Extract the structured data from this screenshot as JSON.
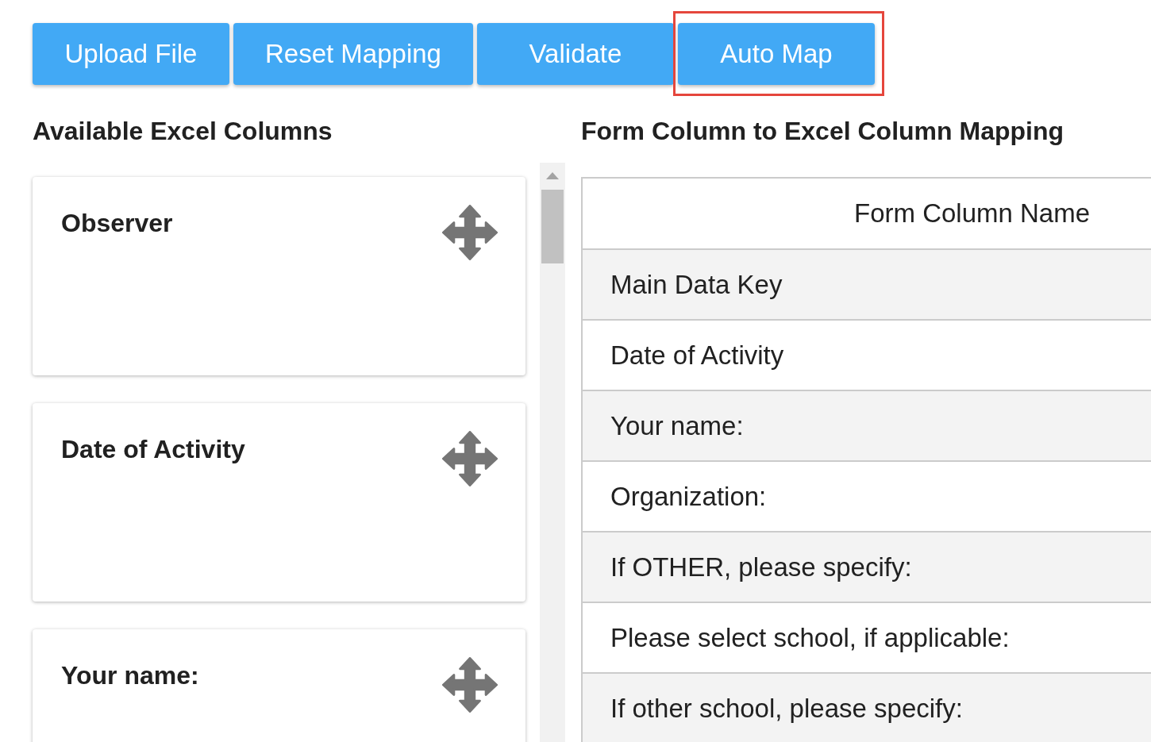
{
  "toolbar": {
    "buttons": [
      {
        "label": "Upload File",
        "highlighted": false
      },
      {
        "label": "Reset Mapping",
        "highlighted": false
      },
      {
        "label": "Validate",
        "highlighted": false
      },
      {
        "label": "Auto Map",
        "highlighted": true
      }
    ]
  },
  "excel_columns": {
    "title": "Available Excel Columns",
    "items": [
      "Observer",
      "Date of Activity",
      "Your name:"
    ]
  },
  "mapping": {
    "title": "Form Column to Excel Column Mapping",
    "table": {
      "columns": [
        "Form Column Name"
      ],
      "rows": [
        [
          "Main Data Key"
        ],
        [
          "Date of Activity"
        ],
        [
          "Your name:"
        ],
        [
          "Organization:"
        ],
        [
          "If OTHER, please specify:"
        ],
        [
          "Please select school, if applicable:"
        ],
        [
          "If other school, please specify:"
        ]
      ]
    }
  }
}
